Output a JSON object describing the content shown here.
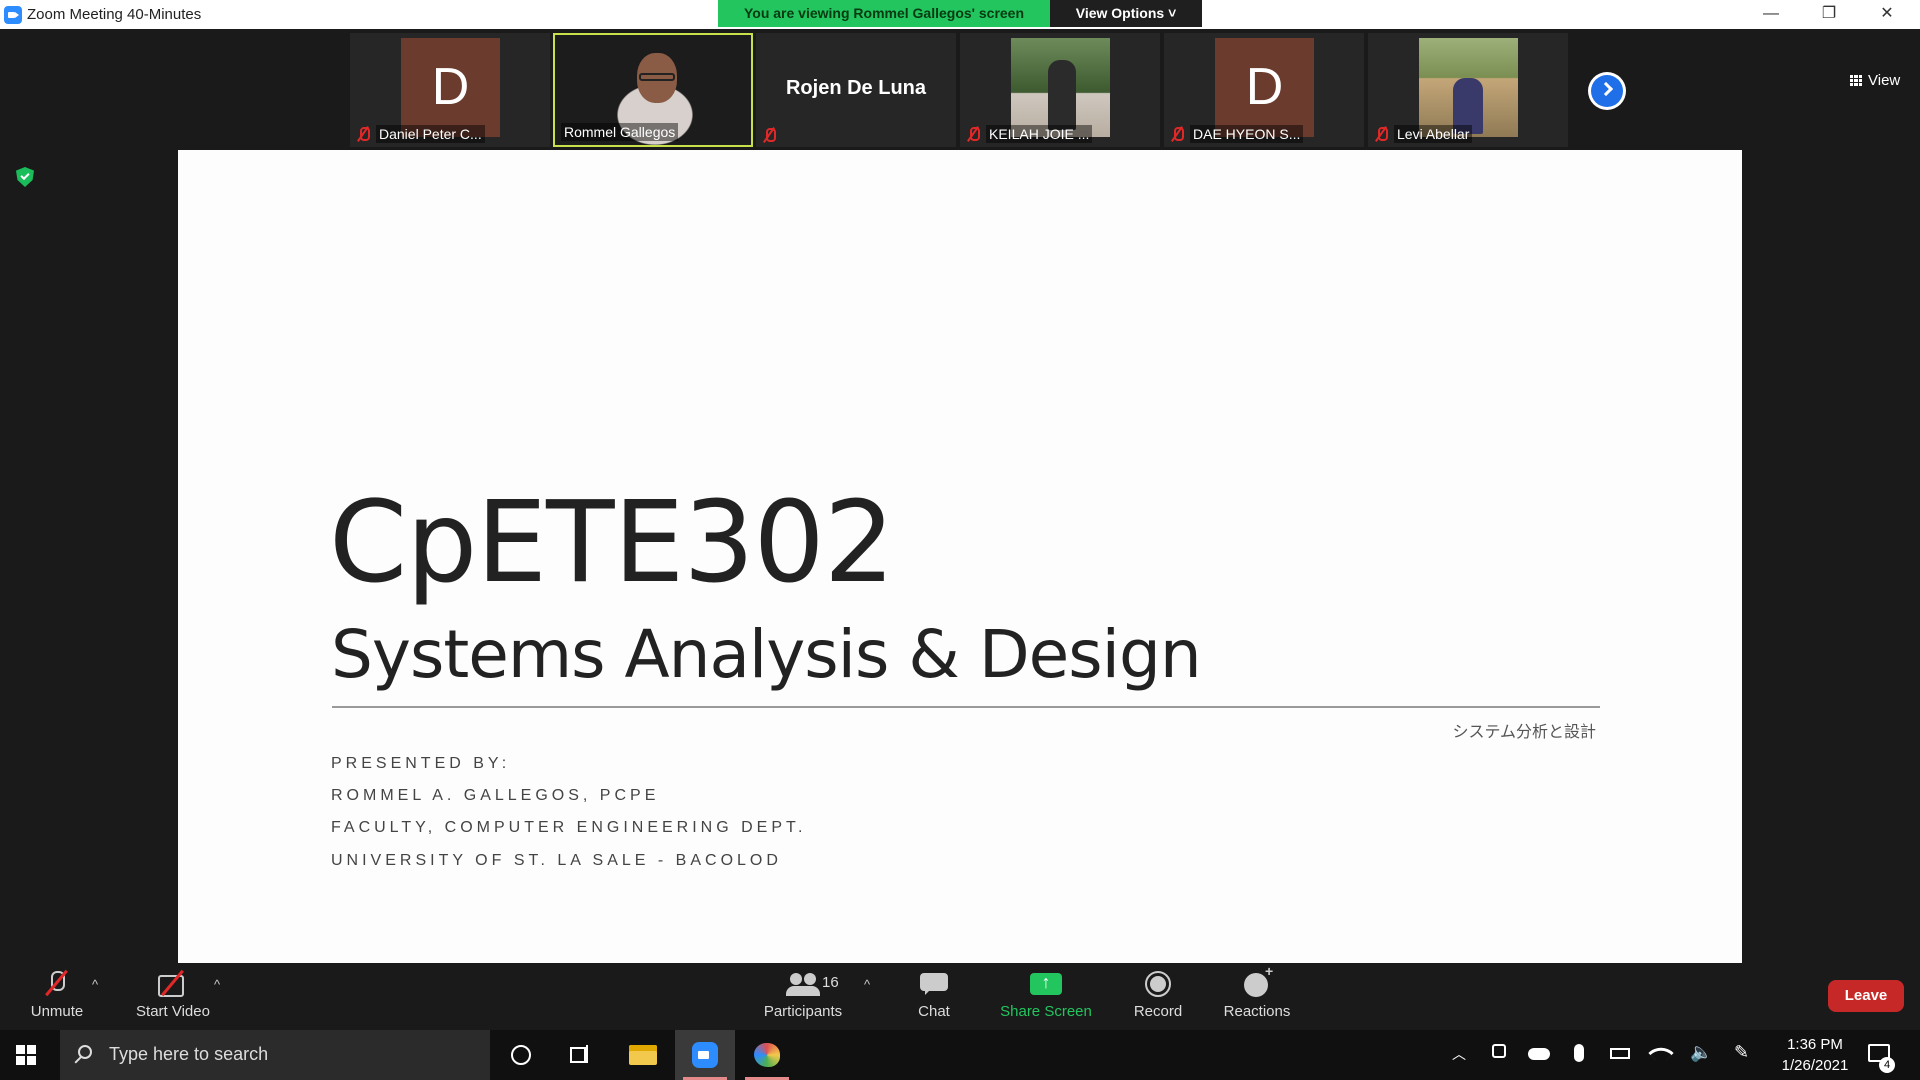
{
  "window": {
    "title": "Zoom Meeting 40-Minutes",
    "viewing_banner": "You are viewing Rommel Gallegos' screen",
    "view_options_label": "View Options",
    "view_label": "View"
  },
  "participants_strip": [
    {
      "name": "Daniel Peter C...",
      "avatar_letter": "D",
      "muted": true
    },
    {
      "name": "Rommel Gallegos",
      "video": true,
      "active_speaker": true
    },
    {
      "name": "Rojen De Luna",
      "muted": true,
      "video": false
    },
    {
      "name": "KEILAH JOIE ...",
      "muted": true,
      "video": true
    },
    {
      "name": "DAE HYEON S...",
      "avatar_letter": "D",
      "muted": true
    },
    {
      "name": "Levi Abellar",
      "muted": true,
      "video": true
    }
  ],
  "slide": {
    "course_code": "CpETE302",
    "course_title": "Systems Analysis & Design",
    "japanese_title": "システム分析と設計",
    "presented_by": "PRESENTED BY:",
    "presenter": "ROMMEL A. GALLEGOS, PCPE",
    "department": "FACULTY, COMPUTER ENGINEERING DEPT.",
    "university": "UNIVERSITY OF ST. LA SALE - BACOLOD"
  },
  "toolbar": {
    "unmute": "Unmute",
    "start_video": "Start Video",
    "participants": "Participants",
    "participant_count": "16",
    "chat": "Chat",
    "share_screen": "Share Screen",
    "record": "Record",
    "reactions": "Reactions",
    "leave": "Leave"
  },
  "taskbar": {
    "search_placeholder": "Type here to search",
    "time": "1:36 PM",
    "date": "1/26/2021",
    "notification_count": "4"
  },
  "colors": {
    "banner_green": "#22c55e",
    "leave_red": "#c62828",
    "zoom_blue": "#2d8cff"
  }
}
